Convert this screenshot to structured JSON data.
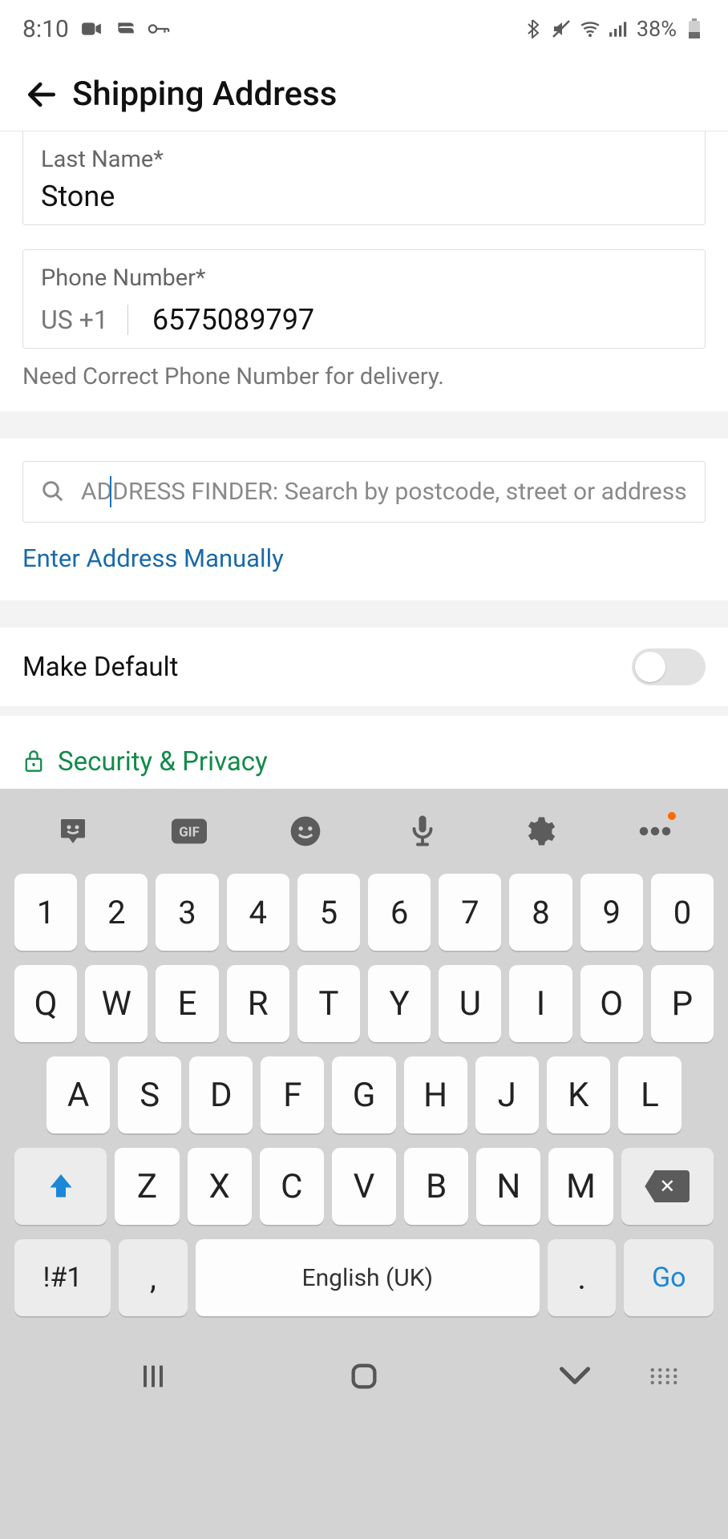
{
  "status": {
    "time": "8:10",
    "battery": "38%"
  },
  "header": {
    "title": "Shipping Address"
  },
  "form": {
    "last_name_label": "Last Name*",
    "last_name_value": "Stone",
    "phone_label": "Phone Number*",
    "phone_prefix": "US +1",
    "phone_value": "6575089797",
    "phone_helper": "Need Correct Phone Number for delivery."
  },
  "search": {
    "placeholder": "ADDRESS FINDER: Search by postcode, street or address",
    "value": ""
  },
  "links": {
    "manual": "Enter Address Manually"
  },
  "default_row": {
    "label": "Make Default",
    "on": false
  },
  "security": {
    "label": "Security & Privacy"
  },
  "keyboard": {
    "rows": {
      "num": [
        "1",
        "2",
        "3",
        "4",
        "5",
        "6",
        "7",
        "8",
        "9",
        "0"
      ],
      "r1": [
        "Q",
        "W",
        "E",
        "R",
        "T",
        "Y",
        "U",
        "I",
        "O",
        "P"
      ],
      "r2": [
        "A",
        "S",
        "D",
        "F",
        "G",
        "H",
        "J",
        "K",
        "L"
      ],
      "r3": [
        "Z",
        "X",
        "C",
        "V",
        "B",
        "N",
        "M"
      ]
    },
    "sym": "!#1",
    "comma": ",",
    "dot": ".",
    "space": "English (UK)",
    "go": "Go"
  }
}
